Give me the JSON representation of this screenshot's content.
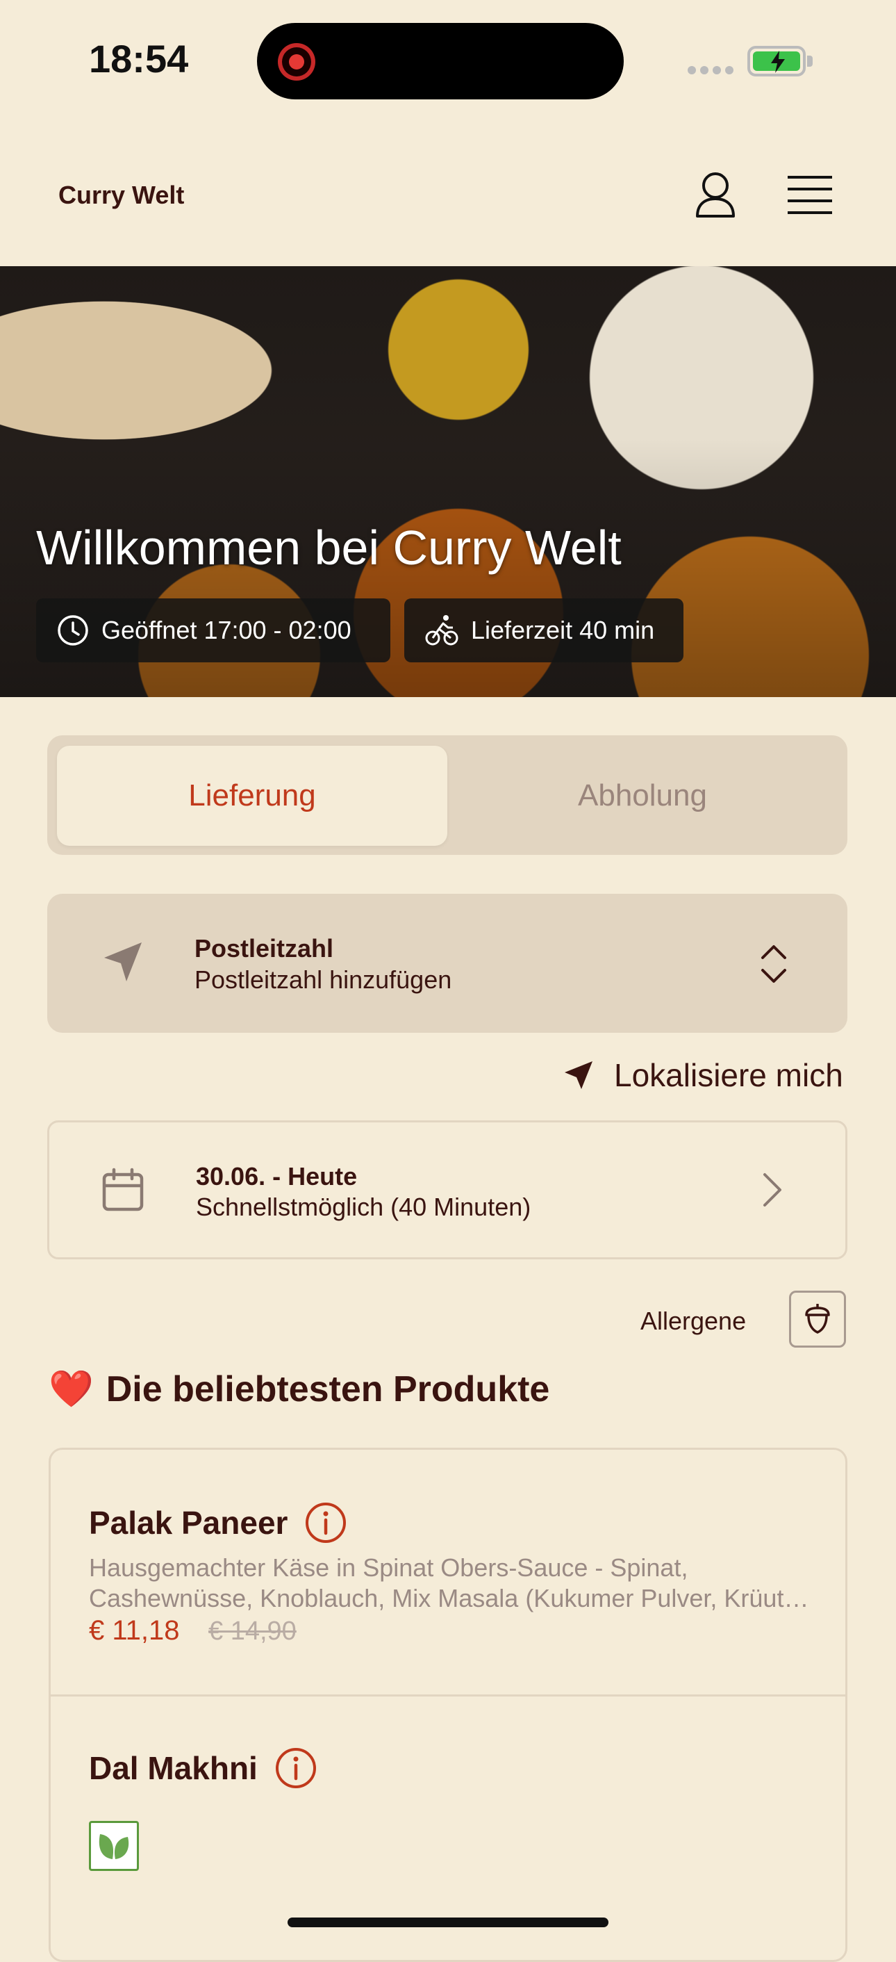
{
  "status_bar": {
    "time": "18:54"
  },
  "header": {
    "brand": "Curry Welt"
  },
  "hero": {
    "title": "Willkommen bei Curry Welt",
    "opening_hours": "Geöffnet 17:00 - 02:00",
    "delivery_time": "Lieferzeit 40 min"
  },
  "order_mode": {
    "options": [
      "Lieferung",
      "Abholung"
    ],
    "selected": "Lieferung"
  },
  "postcode": {
    "label": "Postleitzahl",
    "placeholder": "Postleitzahl hinzufügen"
  },
  "locate_me": "Lokalisiere mich",
  "schedule": {
    "date": "30.06. - Heute",
    "time": "Schnellstmöglich (40 Minuten)"
  },
  "allergens_label": "Allergene",
  "section": {
    "emoji": "❤️",
    "title": "Die beliebtesten Produkte"
  },
  "products": [
    {
      "name": "Palak Paneer",
      "description_line1": "Hausgemachter Käse in Spinat Obers-Sauce - Spinat,",
      "description_line2": "Cashewnüsse, Knoblauch, Mix Masala (Kukumer Pulver, Krüuter, Gewürze)",
      "price": "€ 11,18",
      "old_price": "€ 14,90"
    },
    {
      "name": "Dal Makhni",
      "tag": "vegan-leaf-icon"
    }
  ],
  "colors": {
    "background": "#f5ecd8",
    "accent": "#c0391b",
    "text": "#3a1410",
    "control_bg": "#e2d5c1"
  }
}
